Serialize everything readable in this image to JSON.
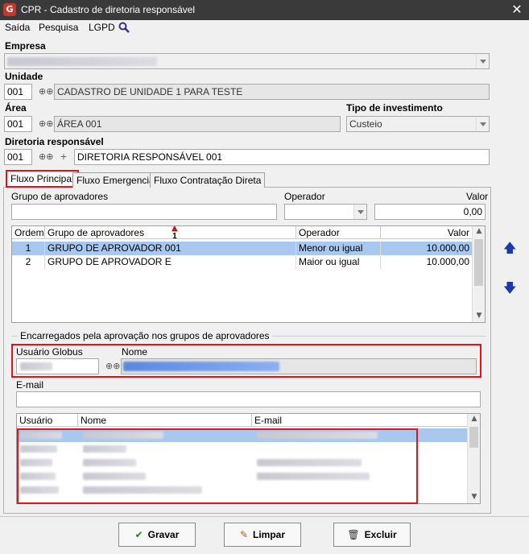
{
  "window": {
    "logo": "G",
    "title": "CPR - Cadastro de diretoria responsável",
    "close": "✕"
  },
  "menu": {
    "items": [
      "Saída",
      "Pesquisa",
      "LGPD"
    ],
    "search_icon": "search-icon"
  },
  "form": {
    "empresa": {
      "label": "Empresa",
      "value": ""
    },
    "unidade": {
      "label": "Unidade",
      "code": "001",
      "name": "CADASTRO DE UNIDADE 1 PARA TESTE"
    },
    "area": {
      "label": "Área",
      "code": "001",
      "name": "ÁREA 001"
    },
    "tipo": {
      "label": "Tipo de investimento",
      "value": "Custeio"
    },
    "diretoria": {
      "label": "Diretoria responsável",
      "code": "001",
      "name": "DIRETORIA RESPONSÁVEL 001"
    }
  },
  "tabs": [
    "Fluxo Principal",
    "Fluxo Emergencial",
    "Fluxo Contratação Direta"
  ],
  "filter": {
    "grupo_label": "Grupo de aprovadores",
    "operador_label": "Operador",
    "valor_label": "Valor",
    "valor_value": "0,00"
  },
  "groups_table": {
    "headers": [
      "Ordem",
      "Grupo de aprovadores",
      "Operador",
      "Valor"
    ],
    "sort_indicator": "1",
    "rows": [
      {
        "ordem": "1",
        "grupo": "GRUPO DE APROVADOR 001",
        "operador": "Menor ou igual",
        "valor": "10.000,00"
      },
      {
        "ordem": "2",
        "grupo": "GRUPO DE APROVADOR E",
        "operador": "Maior ou igual",
        "valor": "10.000,00"
      }
    ]
  },
  "encarregados": {
    "group_label": "Encarregados pela aprovação nos grupos de aprovadores",
    "usuario_label": "Usuário Globus",
    "nome_label": "Nome",
    "email_label": "E-mail",
    "headers": [
      "Usuário",
      "Nome",
      "E-mail"
    ]
  },
  "buttons": {
    "gravar": "Gravar",
    "limpar": "Limpar",
    "excluir": "Excluir"
  },
  "colors": {
    "titlebar": "#3a3a3a",
    "selection": "#a8c8f0",
    "highlight_box": "#e0141c",
    "arrow_blue": "#1a3aa8"
  }
}
